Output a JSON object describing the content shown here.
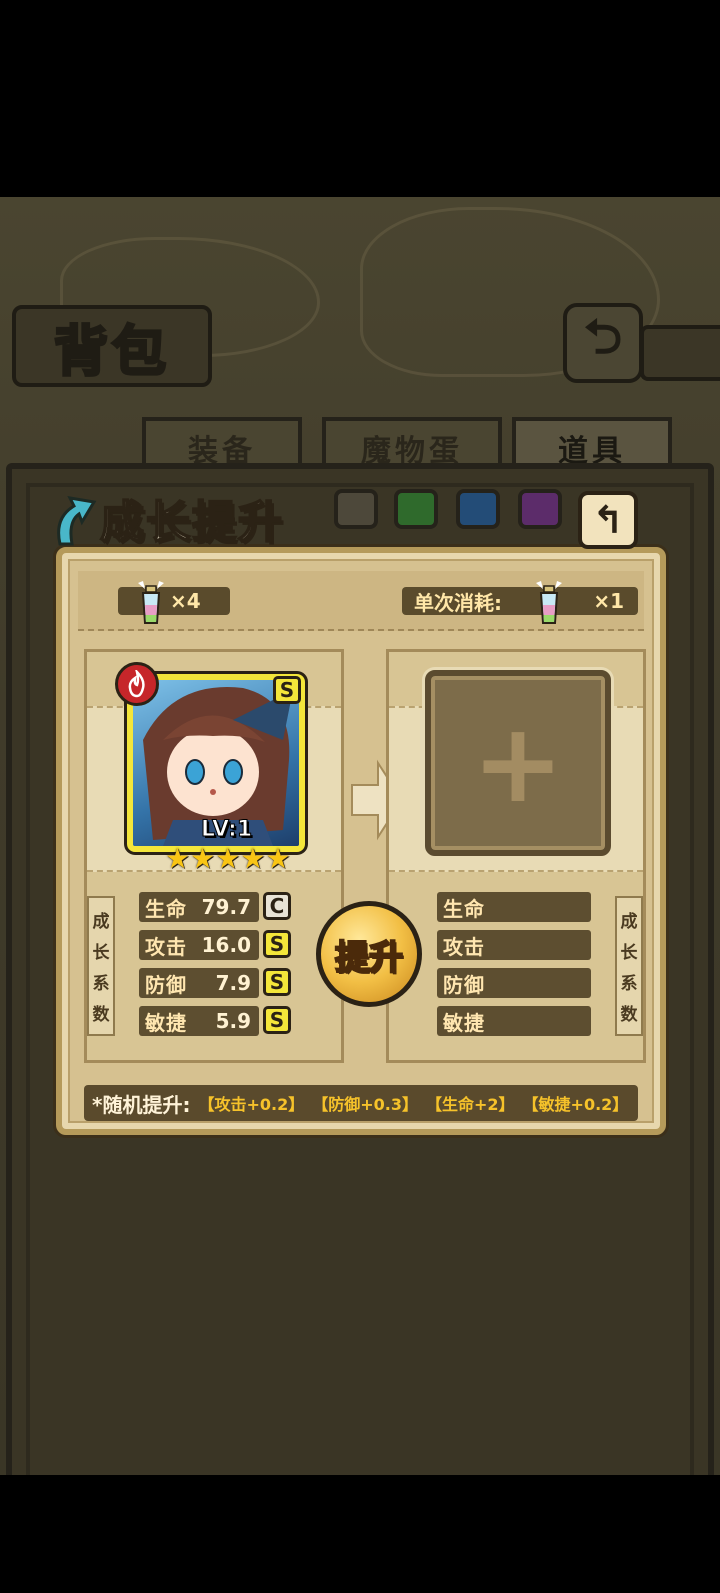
{
  "header": {
    "title": "背包",
    "back_icon": "return-arrow-icon"
  },
  "tabs": [
    {
      "label": "装备",
      "active": false
    },
    {
      "label": "魔物蛋",
      "active": false
    },
    {
      "label": "道具",
      "active": true
    }
  ],
  "dialog": {
    "title": "成长提升",
    "owned_count": "×4",
    "cost_label": "单次消耗:",
    "cost_count": "×1",
    "card": {
      "level": "LV:1",
      "rank": "S",
      "element": "fire",
      "stars": 5
    },
    "side_label_left": [
      "成",
      "长",
      "系",
      "数"
    ],
    "side_label_right": [
      "成",
      "长",
      "系",
      "数"
    ],
    "left_stats": [
      {
        "name": "生命",
        "value": "79.7",
        "grade": "C"
      },
      {
        "name": "攻击",
        "value": "16.0",
        "grade": "S"
      },
      {
        "name": "防御",
        "value": "7.9",
        "grade": "S"
      },
      {
        "name": "敏捷",
        "value": "5.9",
        "grade": "S"
      }
    ],
    "right_stats": [
      {
        "name": "生命"
      },
      {
        "name": "攻击"
      },
      {
        "name": "防御"
      },
      {
        "name": "敏捷"
      }
    ],
    "boost_button": "提升",
    "random_label": "*随机提升:",
    "random_items": [
      "【攻击+0.2】",
      "【防御+0.3】",
      "【生命+2】",
      "【敏捷+0.2】"
    ]
  },
  "colors": {
    "accent": "#f4e63a",
    "panel": "#d8c594",
    "frame": "#b59a5a"
  }
}
